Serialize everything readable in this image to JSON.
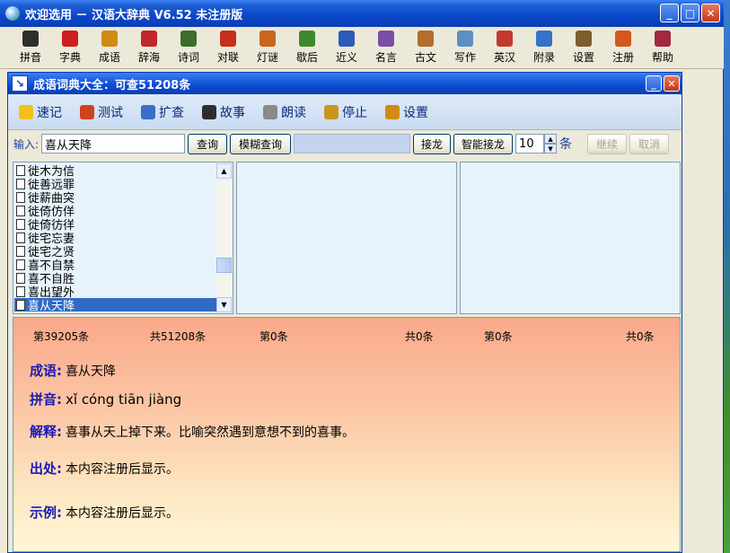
{
  "window": {
    "title": "欢迎选用 － 汉语大辞典 V6.52 未注册版"
  },
  "toolbar": [
    {
      "label": "拼音",
      "color": "#2e2e2e"
    },
    {
      "label": "字典",
      "color": "#cc1f1f"
    },
    {
      "label": "成语",
      "color": "#d08b17"
    },
    {
      "label": "辞海",
      "color": "#c0282a"
    },
    {
      "label": "诗词",
      "color": "#3a6e2d"
    },
    {
      "label": "对联",
      "color": "#c4301c"
    },
    {
      "label": "灯谜",
      "color": "#c8661e"
    },
    {
      "label": "歇后",
      "color": "#3b8a2e"
    },
    {
      "label": "近义",
      "color": "#2c5bb7"
    },
    {
      "label": "名言",
      "color": "#7a4fa3"
    },
    {
      "label": "古文",
      "color": "#b26d2f"
    },
    {
      "label": "写作",
      "color": "#5b8fc4"
    },
    {
      "label": "英汉",
      "color": "#c23a2e"
    },
    {
      "label": "附录",
      "color": "#3672c9"
    },
    {
      "label": "设置",
      "color": "#7d5c2e"
    },
    {
      "label": "注册",
      "color": "#d2581c"
    },
    {
      "label": "帮助",
      "color": "#a3283e"
    }
  ],
  "child": {
    "title": "成语词典大全：可查51208条",
    "commands": [
      {
        "label": "速记",
        "icon": "smiley-icon",
        "color": "#f2c21a"
      },
      {
        "label": "测试",
        "icon": "car-icon",
        "color": "#d0421c"
      },
      {
        "label": "扩查",
        "icon": "arrows-icon",
        "color": "#3a6ec9"
      },
      {
        "label": "故事",
        "icon": "book-icon",
        "color": "#2e2e2e"
      },
      {
        "label": "朗读",
        "icon": "speaker-icon",
        "color": "#8a8a8a"
      },
      {
        "label": "停止",
        "icon": "stop-speaker-icon",
        "color": "#c9951e"
      },
      {
        "label": "设置",
        "icon": "gear-icon",
        "color": "#d08b17"
      }
    ],
    "input": {
      "label": "输入:",
      "value": "喜从天降",
      "query_btn": "查询",
      "fuzzy_btn": "模糊查询",
      "chain_btn": "接龙",
      "smart_chain_btn": "智能接龙",
      "count_value": "10",
      "count_unit": "条",
      "continue_btn": "继续",
      "cancel_btn": "取消"
    },
    "list": {
      "items": [
        "徙木为信",
        "徙善远罪",
        "徙薪曲突",
        "徙倚仿佯",
        "徙倚彷徉",
        "徙宅忘妻",
        "徙宅之贤",
        "喜不自禁",
        "喜不自胜",
        "喜出望外",
        "喜从天降"
      ],
      "selected_index": 10
    },
    "stats": {
      "s1": "第39205条",
      "s2": "共51208条",
      "s3": "第0条",
      "s4": "共0条",
      "s5": "第0条",
      "s6": "共0条"
    },
    "detail": {
      "idiom_k": "成语:",
      "idiom_v": "喜从天降",
      "pinyin_k": "拼音:",
      "pinyin_v": "xǐ cóng tiān jiàng",
      "meaning_k": "解释:",
      "meaning_v": "喜事从天上掉下来。比喻突然遇到意想不到的喜事。",
      "source_k": "出处:",
      "source_v": "本内容注册后显示。",
      "example_k": "示例:",
      "example_v": "本内容注册后显示。"
    }
  }
}
